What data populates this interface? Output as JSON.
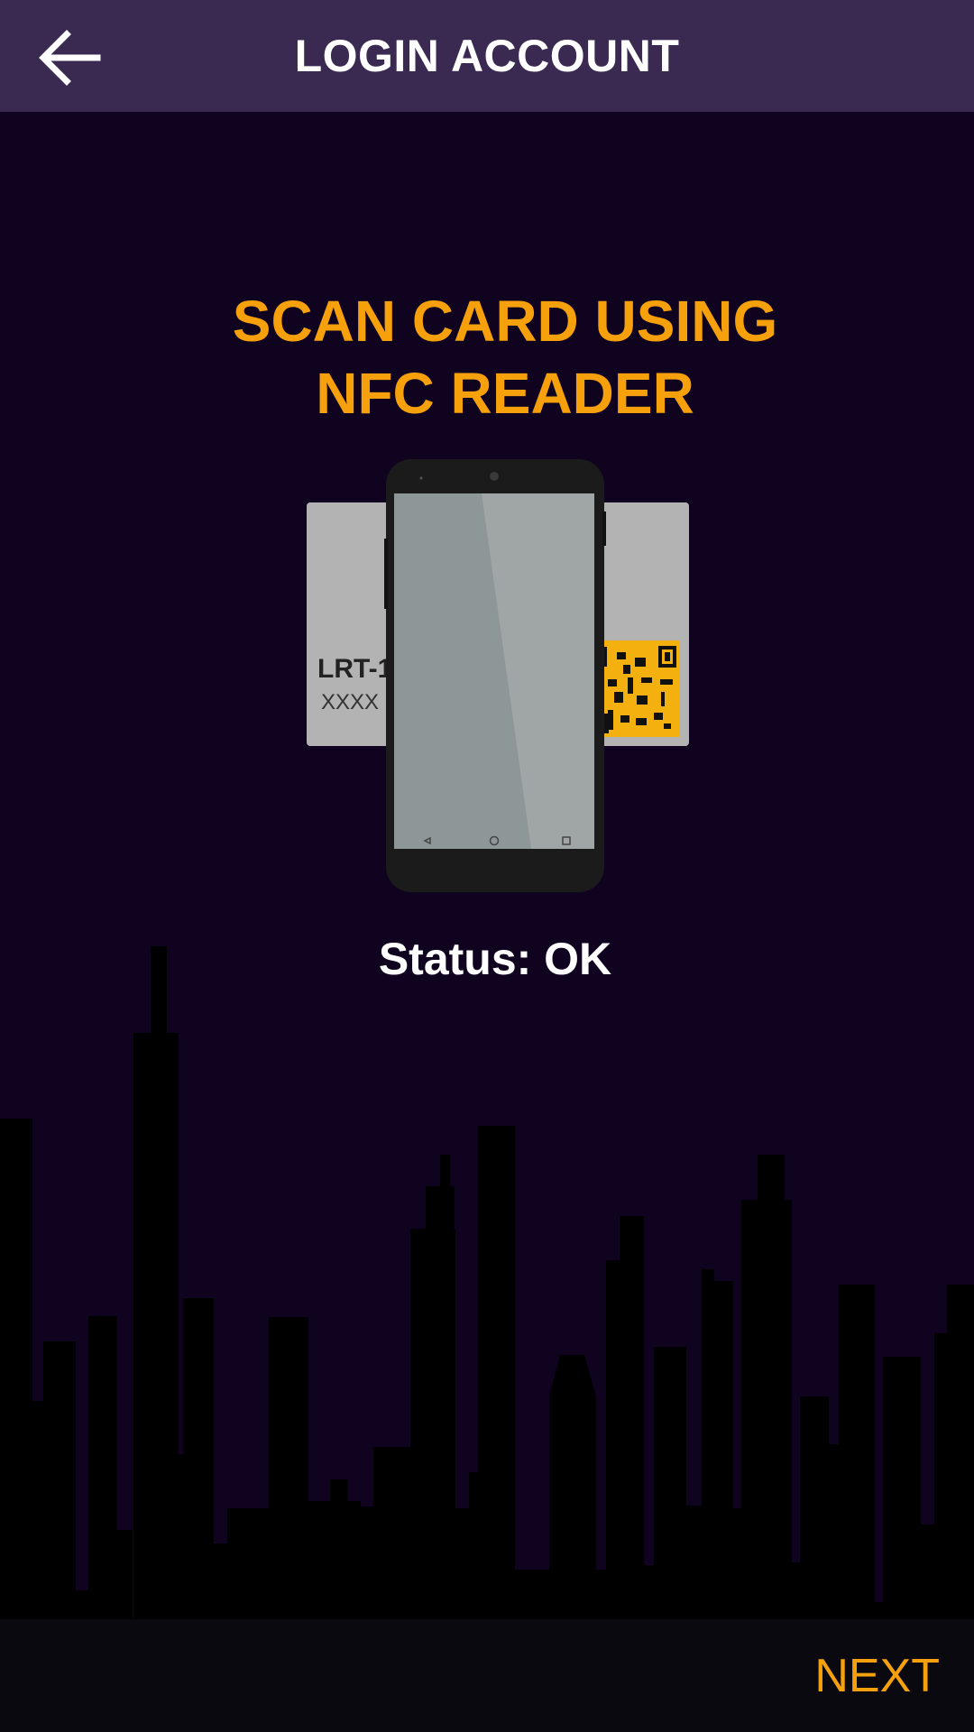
{
  "appbar": {
    "title": "LOGIN ACCOUNT",
    "back_icon": "arrow-left-icon"
  },
  "main": {
    "heading_line1": "SCAN CARD USING",
    "heading_line2": "NFC READER",
    "card_left_title": "LRT-1",
    "card_left_number": "XXXX",
    "status_text": "Status: OK"
  },
  "footer": {
    "next_label": "NEXT"
  },
  "colors": {
    "background": "#10031f",
    "appbar": "#3a2a52",
    "accent": "#f6a10c",
    "text": "#ffffff",
    "bottombar": "#0b0910"
  }
}
